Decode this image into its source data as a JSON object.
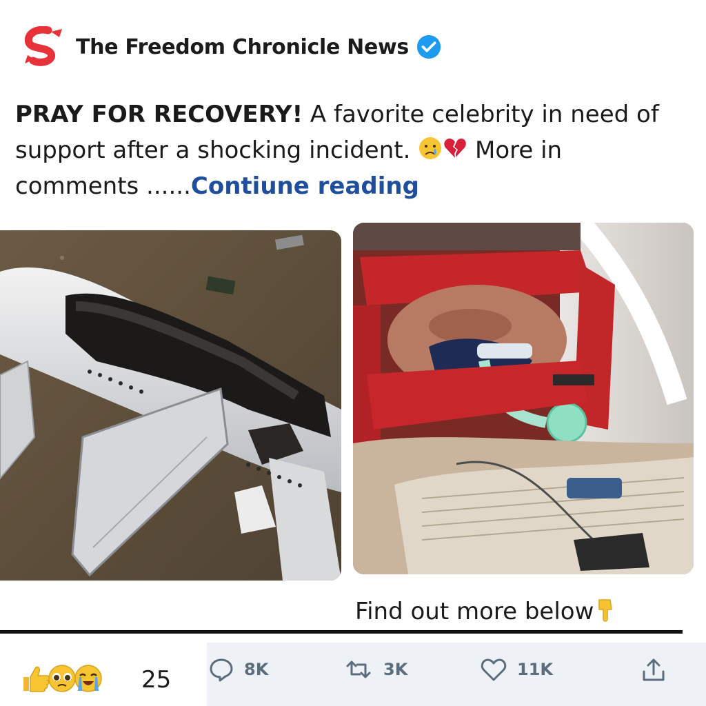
{
  "channel": {
    "name": "The Freedom Chronicle News",
    "logo_icon": "red-s-logo",
    "verified_icon": "verified-badge-icon",
    "brand_color": "#e8323a",
    "verified_color": "#1d9bf0"
  },
  "post": {
    "headline": "PRAY FOR RECOVERY!",
    "body_part1": " A favorite celebrity in need of support after a shocking incident. ",
    "body_part2": " More in comments ......",
    "read_more": "Contiune reading",
    "read_more_color": "#1f4f9c",
    "emojis": [
      "crying-face-emoji",
      "broken-heart-emoji"
    ]
  },
  "images": {
    "left": "wrecked-airplane-photo",
    "right": "patient-on-ventilator-photo"
  },
  "find_more": {
    "text": "Find out more below",
    "icon": "pointing-down-emoji"
  },
  "footer": {
    "reactions": [
      "thumbs-up-emoji",
      "pleading-face-emoji",
      "loudly-crying-emoji"
    ],
    "reaction_count": "25",
    "comments": "8K",
    "reposts": "3K",
    "likes": "11K",
    "share_icon": "share-icon"
  }
}
